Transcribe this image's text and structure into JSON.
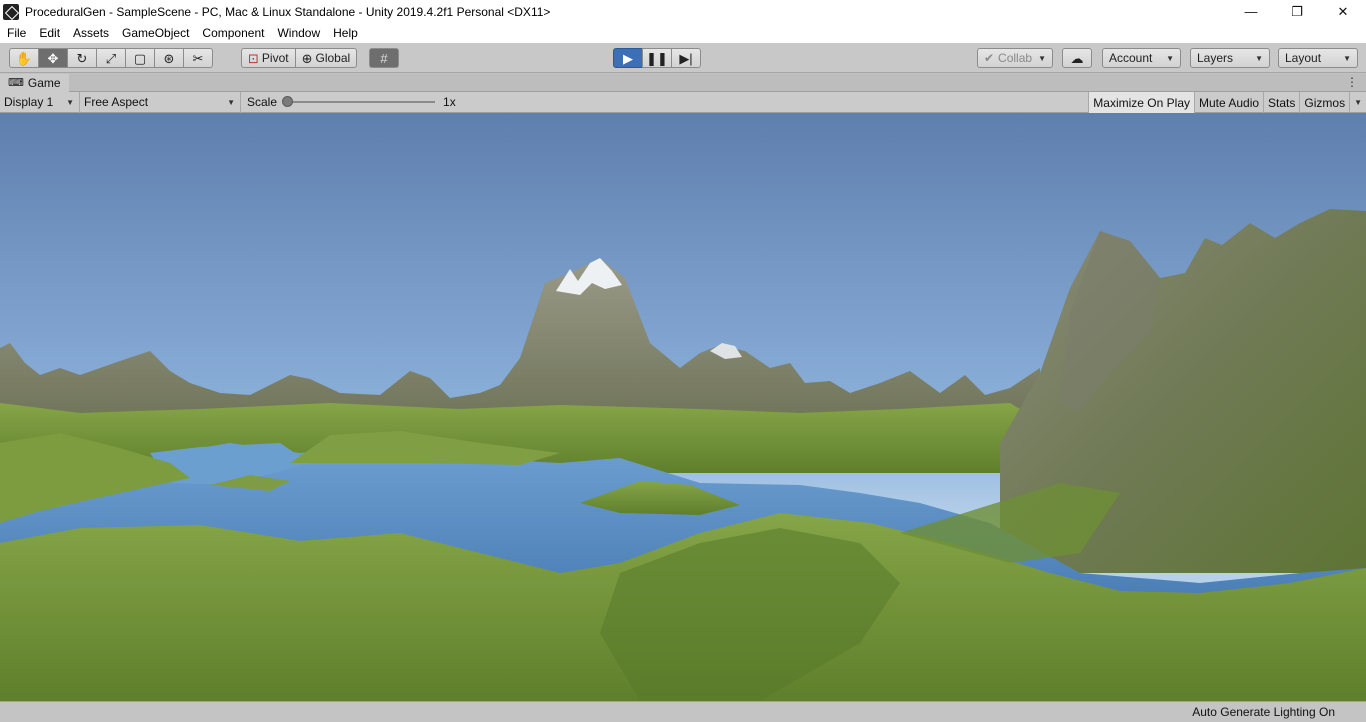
{
  "window": {
    "title": "ProceduralGen - SampleScene - PC, Mac & Linux Standalone - Unity 2019.4.2f1 Personal <DX11>",
    "controls": {
      "minimize": "—",
      "restore": "❐",
      "close": "✕"
    }
  },
  "menu": [
    "File",
    "Edit",
    "Assets",
    "GameObject",
    "Component",
    "Window",
    "Help"
  ],
  "toolbar": {
    "pivot_label": "Pivot",
    "global_label": "Global",
    "collab_label": "Collab",
    "account_label": "Account",
    "layers_label": "Layers",
    "layout_label": "Layout"
  },
  "game_tab": {
    "label": "Game"
  },
  "game_controls": {
    "display": "Display 1",
    "aspect": "Free Aspect",
    "scale_label": "Scale",
    "scale_value": "1x",
    "maximize_on_play": "Maximize On Play",
    "mute_audio": "Mute Audio",
    "stats": "Stats",
    "gizmos": "Gizmos"
  },
  "status": {
    "text": "Auto Generate Lighting On"
  },
  "colors": {
    "play_active": "#3c6fb5",
    "sky_top": "#5f7fae",
    "sky_horizon": "#b8d1ea",
    "water": "#5a8cc4",
    "grass": "#6f8f3a",
    "rock": "#8a8a78"
  }
}
